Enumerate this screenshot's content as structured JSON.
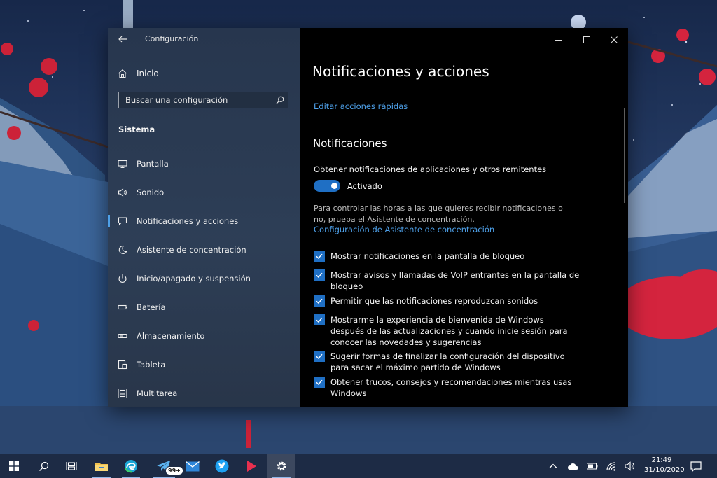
{
  "window": {
    "app_title": "Configuración"
  },
  "nav": {
    "home_label": "Inicio",
    "search_placeholder": "Buscar una configuración",
    "section_heading": "Sistema",
    "items": [
      {
        "label": "Pantalla",
        "icon": "monitor-icon",
        "selected": false
      },
      {
        "label": "Sonido",
        "icon": "speaker-icon",
        "selected": false
      },
      {
        "label": "Notificaciones y acciones",
        "icon": "notification-icon",
        "selected": true
      },
      {
        "label": "Asistente de concentración",
        "icon": "moon-icon",
        "selected": false
      },
      {
        "label": "Inicio/apagado y suspensión",
        "icon": "power-icon",
        "selected": false
      },
      {
        "label": "Batería",
        "icon": "battery-icon",
        "selected": false
      },
      {
        "label": "Almacenamiento",
        "icon": "storage-icon",
        "selected": false
      },
      {
        "label": "Tableta",
        "icon": "tablet-icon",
        "selected": false
      },
      {
        "label": "Multitarea",
        "icon": "multitask-icon",
        "selected": false
      }
    ]
  },
  "content": {
    "page_title": "Notificaciones y acciones",
    "quick_actions_link": "Editar acciones rápidas",
    "notifications_heading": "Notificaciones",
    "get_notifications_label": "Obtener notificaciones de aplicaciones y otros remitentes",
    "toggle_state": "Activado",
    "toggle_on": true,
    "help_text": "Para controlar las horas a las que quieres recibir notificaciones o no, prueba el Asistente de concentración.",
    "focus_assist_link": "Configuración de Asistente de concentración",
    "checkboxes": [
      {
        "label": "Mostrar notificaciones en la pantalla de bloqueo",
        "checked": true
      },
      {
        "label": "Mostrar avisos y llamadas de VoIP entrantes en la pantalla de bloqueo",
        "checked": true
      },
      {
        "label": "Permitir que las notificaciones reproduzcan sonidos",
        "checked": true
      },
      {
        "label": "Mostrarme la experiencia de bienvenida de Windows después de las actualizaciones y cuando inicie sesión para conocer las novedades y sugerencias",
        "checked": true
      },
      {
        "label": "Sugerir formas de finalizar la configuración del dispositivo para sacar el máximo partido de Windows",
        "checked": true
      },
      {
        "label": "Obtener trucos, consejos y recomendaciones mientras usas Windows",
        "checked": true
      }
    ]
  },
  "taskbar": {
    "telegram_badge": "99+",
    "time": "21:49",
    "date": "31/10/2020"
  },
  "colors": {
    "accent": "#1f6fc4",
    "link": "#4ea1ea",
    "content_bg": "#000000",
    "taskbar_bg": "#1d2b45"
  }
}
